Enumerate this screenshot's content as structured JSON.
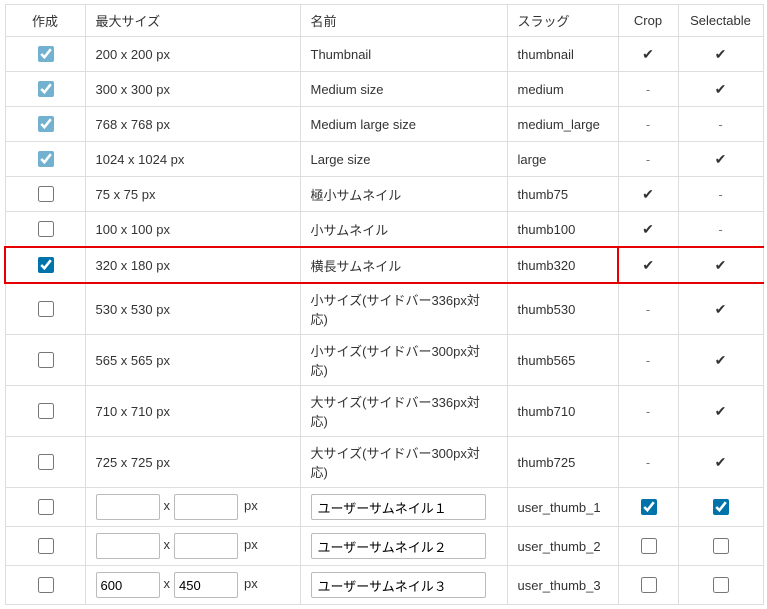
{
  "headers": {
    "create": "作成",
    "max_size": "最大サイズ",
    "name": "名前",
    "slug": "スラッグ",
    "crop": "Crop",
    "selectable": "Selectable"
  },
  "glyphs": {
    "check": "✔",
    "dash": "-",
    "x": "x",
    "px": "px"
  },
  "rows": [
    {
      "create": true,
      "create_faded": true,
      "size": "200 x 200 px",
      "name": "Thumbnail",
      "slug": "thumbnail",
      "crop": "check",
      "selectable": "check"
    },
    {
      "create": true,
      "create_faded": true,
      "size": "300 x 300 px",
      "name": "Medium size",
      "slug": "medium",
      "crop": "dash",
      "selectable": "check"
    },
    {
      "create": true,
      "create_faded": true,
      "size": "768 x 768 px",
      "name": "Medium large size",
      "slug": "medium_large",
      "crop": "dash",
      "selectable": "dash"
    },
    {
      "create": true,
      "create_faded": true,
      "size": "1024 x 1024 px",
      "name": "Large size",
      "slug": "large",
      "crop": "dash",
      "selectable": "check"
    },
    {
      "create": false,
      "create_faded": false,
      "size": "75 x 75 px",
      "name": "極小サムネイル",
      "slug": "thumb75",
      "crop": "check",
      "selectable": "dash"
    },
    {
      "create": false,
      "create_faded": false,
      "size": "100 x 100 px",
      "name": "小サムネイル",
      "slug": "thumb100",
      "crop": "check",
      "selectable": "dash"
    },
    {
      "create": true,
      "create_faded": false,
      "size": "320 x 180 px",
      "name": "横長サムネイル",
      "slug": "thumb320",
      "crop": "check",
      "selectable": "check",
      "highlight": true
    },
    {
      "create": false,
      "create_faded": false,
      "size": "530 x 530 px",
      "name": "小サイズ(サイドバー336px対応)",
      "slug": "thumb530",
      "crop": "dash",
      "selectable": "check"
    },
    {
      "create": false,
      "create_faded": false,
      "size": "565 x 565 px",
      "name": "小サイズ(サイドバー300px対応)",
      "slug": "thumb565",
      "crop": "dash",
      "selectable": "check"
    },
    {
      "create": false,
      "create_faded": false,
      "size": "710 x 710 px",
      "name": "大サイズ(サイドバー336px対応)",
      "slug": "thumb710",
      "crop": "dash",
      "selectable": "check"
    },
    {
      "create": false,
      "create_faded": false,
      "size": "725 x 725 px",
      "name": "大サイズ(サイドバー300px対応)",
      "slug": "thumb725",
      "crop": "dash",
      "selectable": "check"
    }
  ],
  "user_rows": [
    {
      "w": "",
      "h": "",
      "name": "ユーザーサムネイル１",
      "slug": "user_thumb_1",
      "crop": true,
      "selectable": true
    },
    {
      "w": "",
      "h": "",
      "name": "ユーザーサムネイル２",
      "slug": "user_thumb_2",
      "crop": false,
      "selectable": false
    },
    {
      "w": "600",
      "h": "450",
      "name": "ユーザーサムネイル３",
      "slug": "user_thumb_3",
      "crop": false,
      "selectable": false
    }
  ]
}
